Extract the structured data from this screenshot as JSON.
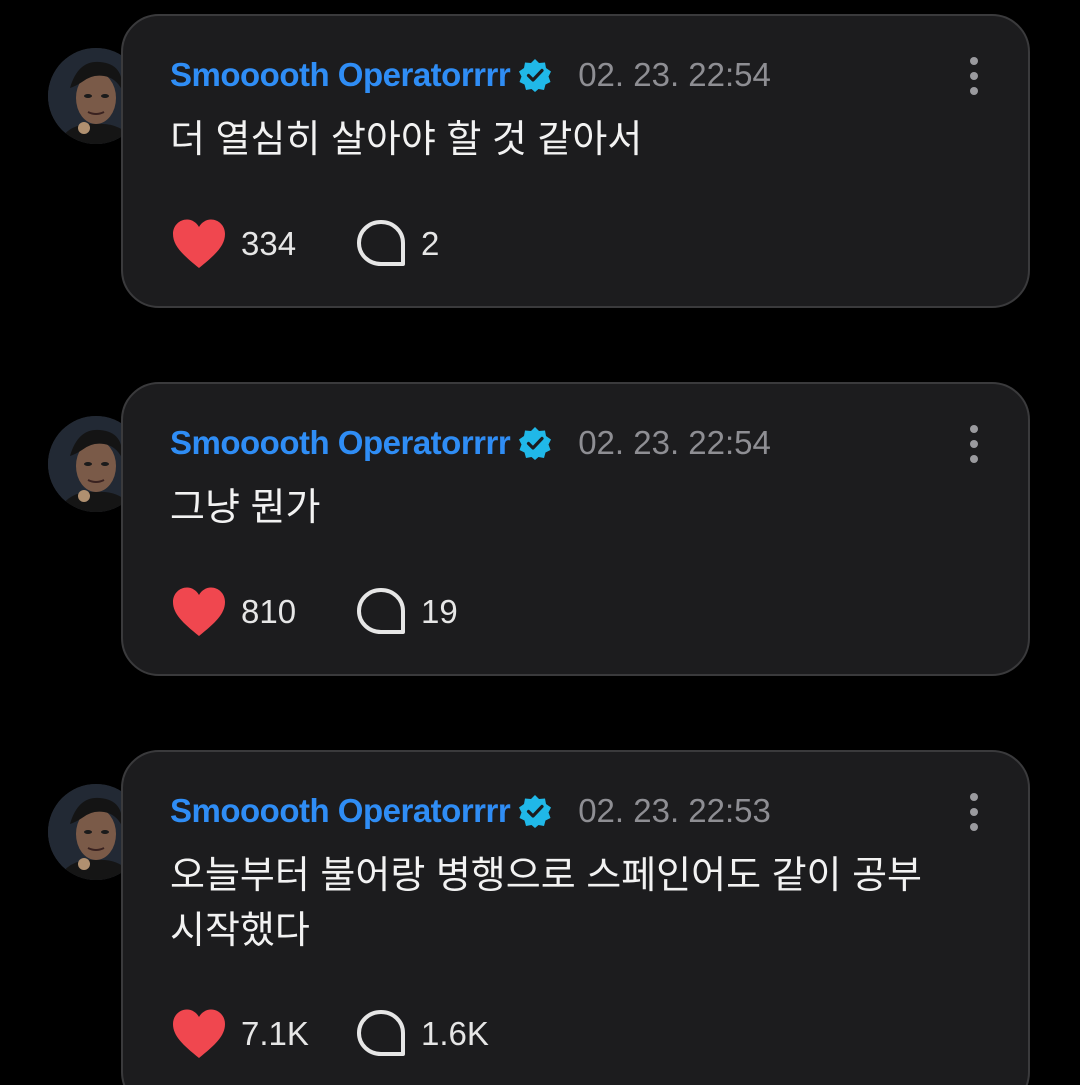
{
  "posts": [
    {
      "username": "Smooooth Operatorrrr",
      "timestamp": "02. 23. 22:54",
      "text": "더 열심히 살아야 할 것 같아서",
      "likes": "334",
      "comments": "2"
    },
    {
      "username": "Smooooth Operatorrrr",
      "timestamp": "02. 23. 22:54",
      "text": "그냥 뭔가",
      "likes": "810",
      "comments": "19"
    },
    {
      "username": "Smooooth Operatorrrr",
      "timestamp": "02. 23. 22:53",
      "text": "오늘부터 불어랑 병행으로 스페인어도 같이 공부 시작했다",
      "likes": "7.1K",
      "comments": "1.6K"
    }
  ],
  "colors": {
    "username": "#2f8df5",
    "verified": "#20b8e8",
    "like": "#f0474f",
    "card_bg": "#1c1c1e",
    "card_border": "#3a3a3c"
  },
  "icons": {
    "verified": "verified-badge-icon",
    "more": "more-vertical-icon",
    "like": "heart-icon",
    "comment": "comment-bubble-icon"
  }
}
